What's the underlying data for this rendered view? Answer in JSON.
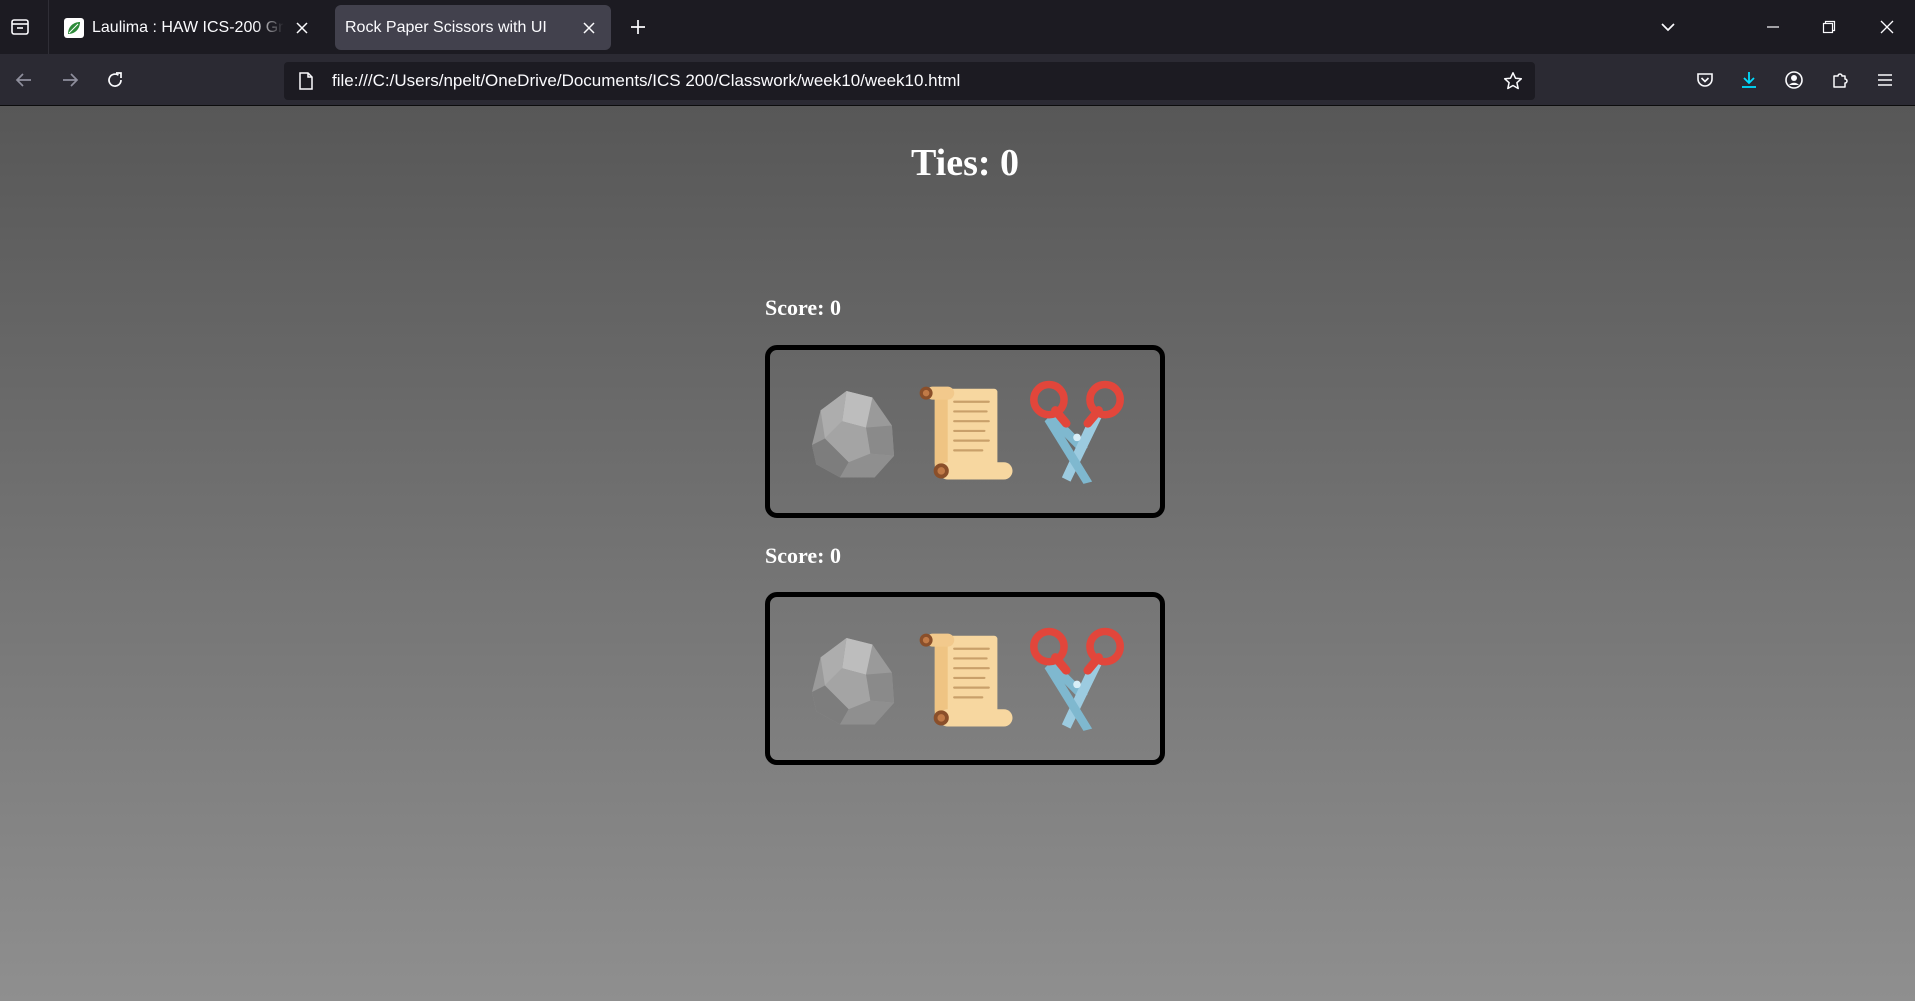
{
  "browser": {
    "tabs": [
      {
        "title": "Laulima : HAW ICS-200 Group [",
        "favicon": "laulima-leaf-icon",
        "active": false
      },
      {
        "title": "Rock Paper Scissors with UI",
        "favicon": null,
        "active": true
      }
    ],
    "url": "file:///C:/Users/npelt/OneDrive/Documents/ICS 200/Classwork/week10/week10.html",
    "accent_color": "#00ddff"
  },
  "page": {
    "ties_text": "Ties: 0",
    "players": [
      {
        "score_text": "Score: 0",
        "choices": [
          {
            "name": "rock",
            "icon": "rock-icon"
          },
          {
            "name": "paper",
            "icon": "paper-scroll-icon"
          },
          {
            "name": "scissors",
            "icon": "scissors-icon"
          }
        ]
      },
      {
        "score_text": "Score: 0",
        "choices": [
          {
            "name": "rock",
            "icon": "rock-icon"
          },
          {
            "name": "paper",
            "icon": "paper-scroll-icon"
          },
          {
            "name": "scissors",
            "icon": "scissors-icon"
          }
        ]
      }
    ]
  }
}
